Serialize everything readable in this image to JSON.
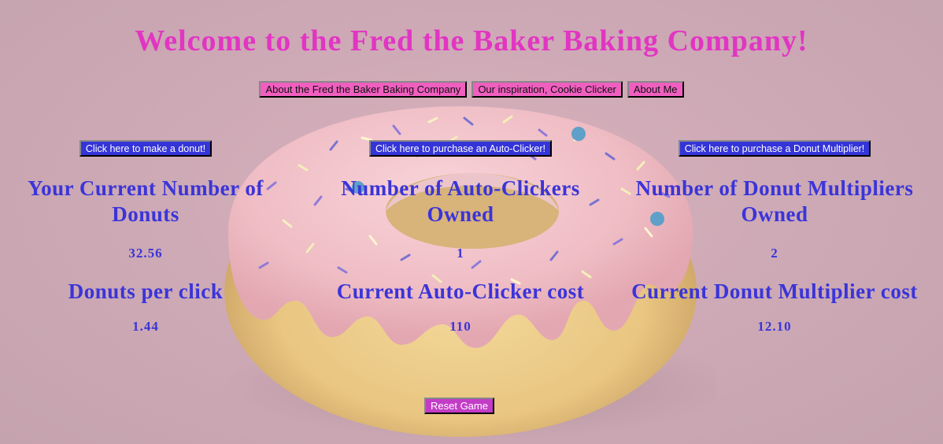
{
  "title": "Welcome to the Fred the Baker Baking Company!",
  "nav": {
    "about_company": "About the Fred the Baker Baking Company",
    "inspiration": "Our inspiration, Cookie Clicker",
    "about_me": "About Me"
  },
  "columns": {
    "donuts": {
      "button": "Click here to make a donut!",
      "heading": "Your Current Number of Donuts",
      "value": "32.56",
      "heading2": "Donuts per click",
      "value2": "1.44"
    },
    "auto_clicker": {
      "button": "Click here to purchase an Auto-Clicker!",
      "heading": "Number of Auto-Clickers Owned",
      "value": "1",
      "heading2": "Current Auto-Clicker cost",
      "value2": "110"
    },
    "multiplier": {
      "button": "Click here to purchase a Donut Multiplier!",
      "heading": "Number of Donut Multipliers Owned",
      "value": "2",
      "heading2": "Current Donut Multiplier cost",
      "value2": "12.10"
    }
  },
  "reset_label": "Reset Game",
  "colors": {
    "title": "#e235c3",
    "heading": "#3a34d9",
    "nav_button": "#f05fc0",
    "action_button": "#3434d8",
    "reset_button": "#c33cc6"
  }
}
